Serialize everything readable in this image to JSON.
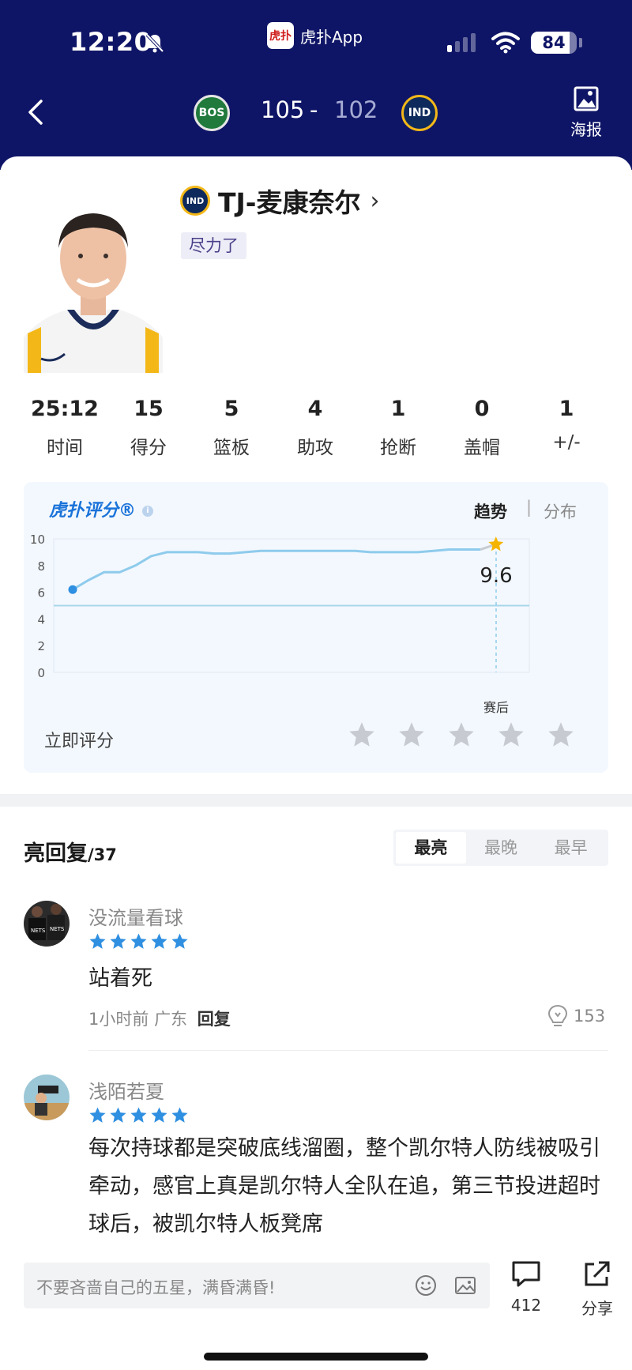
{
  "status_bar": {
    "time": "12:20",
    "app_name": "虎扑App",
    "app_logo_text": "虎扑",
    "battery": "84",
    "battery_level": 0.84
  },
  "header": {
    "home_team": "BOS",
    "away_team": "IND",
    "home_score": "105",
    "score_separator": "-",
    "away_score": "102",
    "poster_label": "海报"
  },
  "player": {
    "team": "IND",
    "name": "TJ-麦康奈尔",
    "tag": "尽力了"
  },
  "stats": [
    {
      "value": "25:12",
      "label": "时间"
    },
    {
      "value": "15",
      "label": "得分"
    },
    {
      "value": "5",
      "label": "篮板"
    },
    {
      "value": "4",
      "label": "助攻"
    },
    {
      "value": "1",
      "label": "抢断"
    },
    {
      "value": "0",
      "label": "盖帽"
    },
    {
      "value": "1",
      "label": "+/-"
    }
  ],
  "rating": {
    "logo_text": "虎扑评分®",
    "tab_trend": "趋势",
    "tab_separator": "|",
    "tab_distribution": "分布",
    "rate_now_label": "立即评分",
    "star_count": 5
  },
  "chart_data": {
    "type": "line",
    "y_ticks": [
      "10",
      "8",
      "6",
      "4",
      "2",
      "0"
    ],
    "ylim": [
      0,
      10
    ],
    "x_marker_label": "赛后",
    "reference_line": 5,
    "series": [
      {
        "values": [
          6.2,
          6.9,
          7.5,
          7.5,
          8.0,
          8.7,
          9.0,
          9.0,
          9.0,
          8.9,
          8.9,
          9.0,
          9.1,
          9.1,
          9.1,
          9.1,
          9.1,
          9.1,
          9.1,
          9.0,
          9.0,
          9.0,
          9.0,
          9.1,
          9.2,
          9.2,
          9.2,
          9.6
        ]
      }
    ],
    "final_value": "9.6",
    "colors": {
      "line": "#8ecbec",
      "start_point": "#2f8fe0",
      "final_star": "#f5b400",
      "reference": "#a7d7ea"
    }
  },
  "replies": {
    "title": "亮回复",
    "count": "/37",
    "sort_tabs": [
      "最亮",
      "最晚",
      "最早"
    ],
    "active_sort": 0,
    "comments": [
      {
        "user": "没流量看球",
        "stars": 5,
        "text": "站着死",
        "time": "1小时前",
        "location": "广东",
        "reply_label": "回复",
        "likes": "153"
      },
      {
        "user": "浅陌若夏",
        "stars": 5,
        "text": "每次持球都是突破底线溜圈，整个凯尔特人防线被吸引牵动，感官上真是凯尔特人全队在追，第三节投进超时球后，被凯尔特人板凳席"
      }
    ]
  },
  "bottom_bar": {
    "input_placeholder": "不要吝啬自己的五星，满昏满昏!",
    "comment_count": "412",
    "share_label": "分享"
  },
  "colors": {
    "header_bg": "#0f1566",
    "accent_blue": "#2f8fe0",
    "star_gray": "#c7cbd1"
  }
}
